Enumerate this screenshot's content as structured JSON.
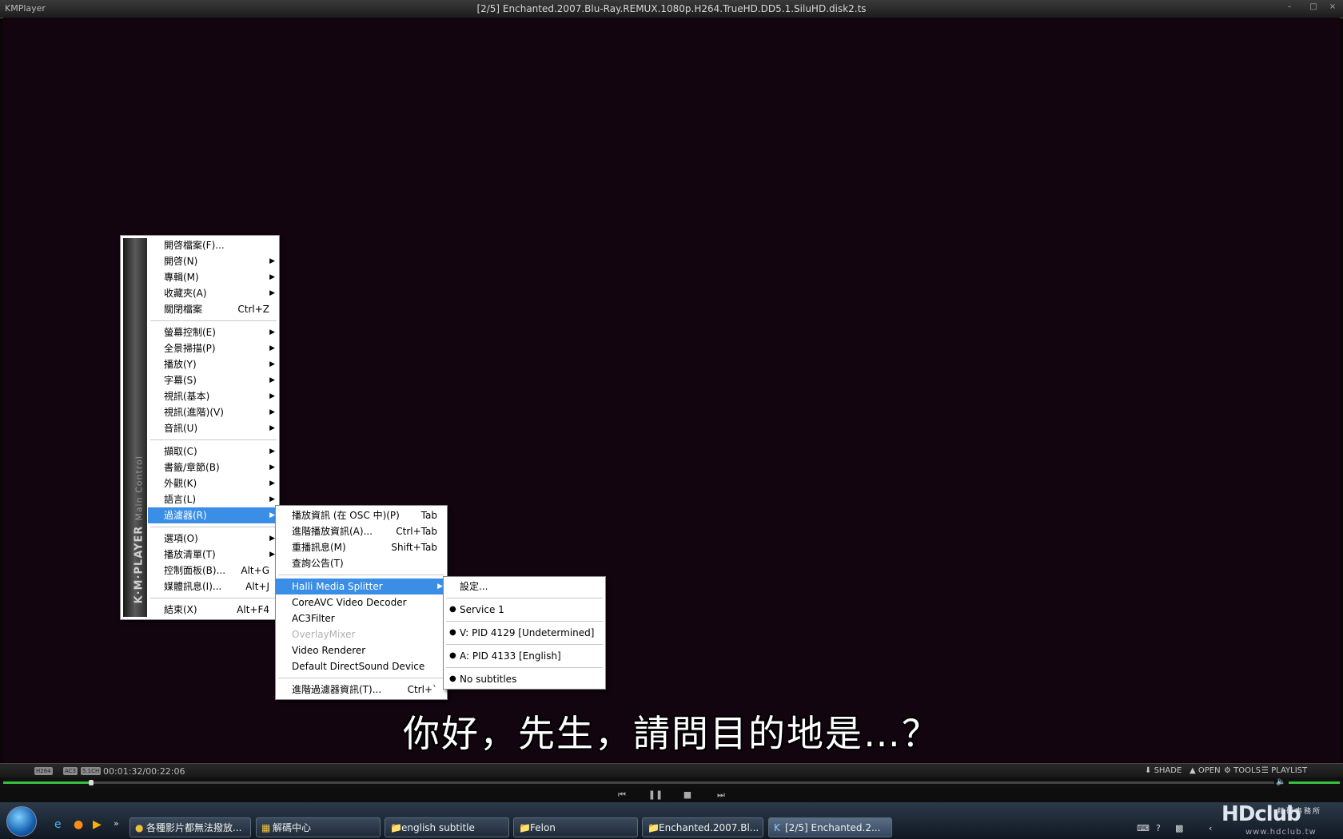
{
  "window": {
    "app_name": "KMPlayer",
    "title": "[2/5] Enchanted.2007.Blu-Ray.REMUX.1080p.H264.TrueHD.DD5.1.SiluHD.disk2.ts"
  },
  "subtitle_text": "你好，先生，請問目的地是…？",
  "main_menu": {
    "banner_title": "K·M·PLAYER",
    "banner_subtitle": "Main Control",
    "groups": [
      [
        {
          "label": "開啓檔案(F)...",
          "shortcut": "",
          "submenu": false
        },
        {
          "label": "開啓(N)",
          "shortcut": "",
          "submenu": true
        },
        {
          "label": "專輯(M)",
          "shortcut": "",
          "submenu": true
        },
        {
          "label": "收藏夾(A)",
          "shortcut": "",
          "submenu": true
        },
        {
          "label": "關閉檔案",
          "shortcut": "Ctrl+Z",
          "submenu": false
        }
      ],
      [
        {
          "label": "螢幕控制(E)",
          "shortcut": "",
          "submenu": true
        },
        {
          "label": "全景掃描(P)",
          "shortcut": "",
          "submenu": true
        },
        {
          "label": "播放(Y)",
          "shortcut": "",
          "submenu": true
        },
        {
          "label": "字幕(S)",
          "shortcut": "",
          "submenu": true
        },
        {
          "label": "視訊(基本)",
          "shortcut": "",
          "submenu": true
        },
        {
          "label": "視訊(進階)(V)",
          "shortcut": "",
          "submenu": true
        },
        {
          "label": "音訊(U)",
          "shortcut": "",
          "submenu": true
        }
      ],
      [
        {
          "label": "擷取(C)",
          "shortcut": "",
          "submenu": true
        },
        {
          "label": "書籤/章節(B)",
          "shortcut": "",
          "submenu": true
        },
        {
          "label": "外觀(K)",
          "shortcut": "",
          "submenu": true
        },
        {
          "label": "語言(L)",
          "shortcut": "",
          "submenu": true
        },
        {
          "label": "過濾器(R)",
          "shortcut": "",
          "submenu": true,
          "highlighted": true
        }
      ],
      [
        {
          "label": "選項(O)",
          "shortcut": "",
          "submenu": true
        },
        {
          "label": "播放清單(T)",
          "shortcut": "",
          "submenu": true
        },
        {
          "label": "控制面板(B)...",
          "shortcut": "Alt+G",
          "submenu": false
        },
        {
          "label": "媒體訊息(I)...",
          "shortcut": "Alt+J",
          "submenu": false
        }
      ],
      [
        {
          "label": "結束(X)",
          "shortcut": "Alt+F4",
          "submenu": false
        }
      ]
    ]
  },
  "filter_menu": {
    "top_items": [
      {
        "label": "播放資訊 (在 OSC 中)(P)",
        "shortcut": "Tab"
      },
      {
        "label": "進階播放資訊(A)...",
        "shortcut": "Ctrl+Tab"
      },
      {
        "label": "重播訊息(M)",
        "shortcut": "Shift+Tab"
      },
      {
        "label": "查詢公告(T)",
        "shortcut": ""
      }
    ],
    "filters": [
      {
        "label": "Halli Media Splitter",
        "submenu": true,
        "highlighted": true,
        "disabled": false
      },
      {
        "label": "CoreAVC Video Decoder",
        "submenu": false,
        "highlighted": false,
        "disabled": false
      },
      {
        "label": "AC3Filter",
        "submenu": false,
        "highlighted": false,
        "disabled": false
      },
      {
        "label": "OverlayMixer",
        "submenu": false,
        "highlighted": false,
        "disabled": true
      },
      {
        "label": "Video Renderer",
        "submenu": false,
        "highlighted": false,
        "disabled": false
      },
      {
        "label": "Default DirectSound Device",
        "submenu": false,
        "highlighted": false,
        "disabled": false
      }
    ],
    "bottom_item": {
      "label": "進階過濾器資訊(T)...",
      "shortcut": "Ctrl+`"
    }
  },
  "splitter_menu": {
    "settings_label": "設定...",
    "streams": [
      "Service 1",
      "V: PID 4129 [Undetermined]",
      "A: PID 4133 [English]",
      "No subtitles"
    ]
  },
  "statusbar": {
    "codec_chips": [
      "H264",
      "AC3",
      "5.1CH"
    ],
    "time": "00:01:32/00:22:06",
    "shade_label": "SHADE",
    "open_label": "OPEN",
    "tools_label": "TOOLS",
    "playlist_label": "PLAYLIST"
  },
  "playback": {
    "position_fraction": 0.0694
  },
  "taskbar": {
    "tasks": [
      {
        "label": "各種影片都無法撥放...",
        "active": false
      },
      {
        "label": "解碼中心",
        "active": false
      },
      {
        "label": "english subtitle",
        "active": false
      },
      {
        "label": "Felon",
        "active": false
      },
      {
        "label": "Enchanted.2007.Bl...",
        "active": false
      },
      {
        "label": "[2/5] Enchanted.2...",
        "active": true
      }
    ],
    "watermark": "HDclub",
    "watermark_small": "精研事務所",
    "watermark_url": "www.hdclub.tw"
  },
  "colors": {
    "menu_highlight": "#3a8ee6",
    "seek_fill": "#38c040",
    "video_bg": "#130510"
  }
}
